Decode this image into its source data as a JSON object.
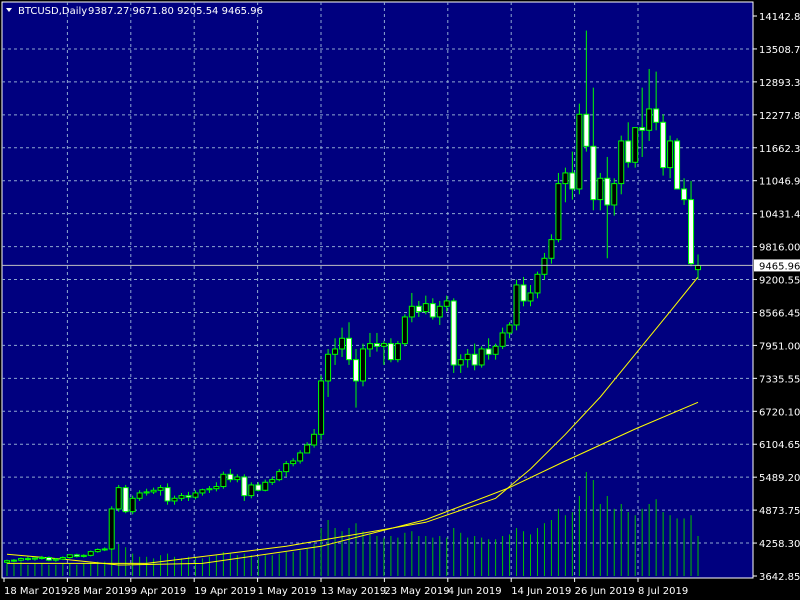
{
  "chart_data": {
    "type": "candlestick",
    "symbol_header": "BTCUSD,Daily",
    "ohlc_header": "9387.27 9671.80 9205.54 9465.96",
    "colors": {
      "background": "#000000",
      "plot_background": "#00007F",
      "grid": "#8FA8D0",
      "candle_stroke": "#00FF00",
      "bull_fill": "#000000",
      "bear_fill": "#FFFFFF",
      "volume": "#00C000",
      "ma": "#FFFF00",
      "text": "#FFFFFF",
      "current_line": "#C0C0C0"
    },
    "y_axis": {
      "range": [
        3642.85,
        14142.8
      ],
      "ticks": [
        "14142.80",
        "13508.70",
        "12893.35",
        "12277.80",
        "11662.35",
        "11046.90",
        "10431.45",
        "9816.00",
        "9200.55",
        "8566.45",
        "7951.00",
        "7335.55",
        "6720.10",
        "6104.65",
        "5489.20",
        "4873.75",
        "4258.30",
        "3642.85"
      ]
    },
    "current_price": "9465.96",
    "x_axis": {
      "labels": [
        "18 Mar 2019",
        "28 Mar 2019",
        "9 Apr 2019",
        "19 Apr 2019",
        "1 May 2019",
        "13 May 2019",
        "23 May 2019",
        "4 Jun 2019",
        "14 Jun 2019",
        "26 Jun 2019",
        "8 Jul 2019"
      ]
    },
    "candles": [
      [
        3900,
        3950,
        3880,
        3930
      ],
      [
        3930,
        3960,
        3900,
        3940
      ],
      [
        3940,
        3990,
        3920,
        3970
      ],
      [
        3970,
        4010,
        3930,
        3960
      ],
      [
        3960,
        3990,
        3930,
        3980
      ],
      [
        3980,
        4020,
        3950,
        3990
      ],
      [
        3990,
        4010,
        3920,
        3940
      ],
      [
        3940,
        3980,
        3910,
        3960
      ],
      [
        3960,
        4010,
        3940,
        3990
      ],
      [
        3990,
        4050,
        3970,
        4040
      ],
      [
        4040,
        4060,
        3990,
        4010
      ],
      [
        4010,
        4050,
        3990,
        4030
      ],
      [
        4030,
        4120,
        4010,
        4100
      ],
      [
        4100,
        4160,
        4080,
        4140
      ],
      [
        4140,
        4180,
        4110,
        4150
      ],
      [
        4150,
        4950,
        4130,
        4900
      ],
      [
        4900,
        5350,
        4850,
        5300
      ],
      [
        5300,
        5350,
        4820,
        4850
      ],
      [
        4850,
        5150,
        4800,
        5100
      ],
      [
        5100,
        5250,
        5050,
        5200
      ],
      [
        5200,
        5280,
        5150,
        5220
      ],
      [
        5220,
        5300,
        5180,
        5250
      ],
      [
        5250,
        5350,
        5150,
        5300
      ],
      [
        5300,
        5380,
        4980,
        5050
      ],
      [
        5050,
        5150,
        4980,
        5100
      ],
      [
        5100,
        5200,
        5050,
        5150
      ],
      [
        5150,
        5220,
        5050,
        5120
      ],
      [
        5120,
        5250,
        5080,
        5200
      ],
      [
        5200,
        5280,
        5150,
        5260
      ],
      [
        5260,
        5330,
        5200,
        5280
      ],
      [
        5280,
        5400,
        5230,
        5320
      ],
      [
        5320,
        5600,
        5280,
        5550
      ],
      [
        5550,
        5650,
        5400,
        5450
      ],
      [
        5450,
        5550,
        5400,
        5500
      ],
      [
        5500,
        5550,
        5050,
        5150
      ],
      [
        5150,
        5400,
        5100,
        5350
      ],
      [
        5350,
        5400,
        5230,
        5250
      ],
      [
        5250,
        5450,
        5230,
        5400
      ],
      [
        5400,
        5500,
        5350,
        5450
      ],
      [
        5450,
        5650,
        5420,
        5600
      ],
      [
        5600,
        5800,
        5500,
        5750
      ],
      [
        5750,
        5850,
        5700,
        5800
      ],
      [
        5800,
        6000,
        5750,
        5950
      ],
      [
        5950,
        6150,
        5950,
        6100
      ],
      [
        6100,
        6400,
        6050,
        6300
      ],
      [
        6300,
        7400,
        6200,
        7300
      ],
      [
        7300,
        7900,
        7000,
        7800
      ],
      [
        7800,
        8100,
        7600,
        7900
      ],
      [
        7900,
        8300,
        7750,
        8100
      ],
      [
        8100,
        8400,
        7600,
        7700
      ],
      [
        7700,
        7900,
        6800,
        7300
      ],
      [
        7300,
        8000,
        7200,
        7900
      ],
      [
        7900,
        8200,
        7750,
        8000
      ],
      [
        8000,
        8200,
        7850,
        7950
      ],
      [
        7950,
        8050,
        7600,
        8000
      ],
      [
        8000,
        8100,
        7650,
        7700
      ],
      [
        7700,
        8050,
        7650,
        8000
      ],
      [
        8000,
        8550,
        7950,
        8500
      ],
      [
        8500,
        8950,
        8400,
        8700
      ],
      [
        8700,
        8800,
        8500,
        8600
      ],
      [
        8600,
        8900,
        8550,
        8750
      ],
      [
        8750,
        8850,
        8450,
        8500
      ],
      [
        8500,
        8800,
        8350,
        8700
      ],
      [
        8700,
        8900,
        8600,
        8800
      ],
      [
        8800,
        8850,
        7450,
        7600
      ],
      [
        7600,
        7800,
        7450,
        7700
      ],
      [
        7700,
        7900,
        7550,
        7800
      ],
      [
        7800,
        8000,
        7500,
        7600
      ],
      [
        7600,
        7950,
        7550,
        7900
      ],
      [
        7900,
        8100,
        7700,
        7800
      ],
      [
        7800,
        8000,
        7700,
        7950
      ],
      [
        7950,
        8300,
        7900,
        8200
      ],
      [
        8200,
        8400,
        8100,
        8350
      ],
      [
        8350,
        9200,
        8250,
        9100
      ],
      [
        9100,
        9250,
        8700,
        8800
      ],
      [
        8800,
        9100,
        8700,
        8950
      ],
      [
        8950,
        9350,
        8850,
        9300
      ],
      [
        9300,
        9700,
        9200,
        9600
      ],
      [
        9600,
        10050,
        9500,
        9950
      ],
      [
        9950,
        11200,
        9900,
        11000
      ],
      [
        11000,
        11300,
        10650,
        11200
      ],
      [
        11200,
        11600,
        10700,
        10900
      ],
      [
        10900,
        12500,
        10800,
        12300
      ],
      [
        12300,
        13870,
        11600,
        11700
      ],
      [
        11700,
        12800,
        10500,
        10700
      ],
      [
        10700,
        11200,
        10500,
        11100
      ],
      [
        11100,
        11500,
        9600,
        10600
      ],
      [
        10600,
        11100,
        10400,
        11000
      ],
      [
        11000,
        11900,
        10800,
        11800
      ],
      [
        11800,
        12150,
        11300,
        11400
      ],
      [
        11400,
        12000,
        11300,
        12050
      ],
      [
        12050,
        12800,
        11500,
        12000
      ],
      [
        12000,
        13150,
        11800,
        12400
      ],
      [
        12400,
        13100,
        12000,
        12150
      ],
      [
        12150,
        12300,
        11150,
        11300
      ],
      [
        11300,
        11900,
        11100,
        11800
      ],
      [
        11800,
        11850,
        10900,
        10900
      ],
      [
        10900,
        11100,
        10600,
        10700
      ],
      [
        10700,
        11050,
        9450,
        9500
      ],
      [
        9387.27,
        9671.8,
        9205.54,
        9465.96
      ]
    ],
    "volumes": [
      0.08,
      0.08,
      0.09,
      0.07,
      0.08,
      0.08,
      0.07,
      0.07,
      0.08,
      0.08,
      0.07,
      0.08,
      0.09,
      0.09,
      0.09,
      0.18,
      0.2,
      0.18,
      0.14,
      0.12,
      0.12,
      0.11,
      0.13,
      0.14,
      0.12,
      0.11,
      0.12,
      0.12,
      0.11,
      0.12,
      0.13,
      0.15,
      0.14,
      0.13,
      0.14,
      0.13,
      0.12,
      0.13,
      0.13,
      0.14,
      0.15,
      0.15,
      0.16,
      0.17,
      0.2,
      0.3,
      0.35,
      0.3,
      0.28,
      0.3,
      0.33,
      0.28,
      0.26,
      0.25,
      0.24,
      0.25,
      0.24,
      0.27,
      0.28,
      0.25,
      0.25,
      0.24,
      0.25,
      0.24,
      0.3,
      0.27,
      0.24,
      0.25,
      0.24,
      0.23,
      0.23,
      0.25,
      0.26,
      0.3,
      0.28,
      0.26,
      0.3,
      0.33,
      0.35,
      0.42,
      0.38,
      0.4,
      0.5,
      0.65,
      0.6,
      0.45,
      0.5,
      0.42,
      0.45,
      0.4,
      0.38,
      0.42,
      0.45,
      0.48,
      0.4,
      0.38,
      0.36,
      0.36,
      0.38,
      0.25
    ],
    "ma_fast": [
      [
        0,
        3880
      ],
      [
        20,
        3880
      ],
      [
        40,
        4200
      ],
      [
        60,
        4650
      ],
      [
        70,
        5100
      ],
      [
        75,
        5650
      ],
      [
        80,
        6300
      ],
      [
        85,
        7000
      ],
      [
        90,
        7800
      ],
      [
        95,
        8600
      ],
      [
        99,
        9250
      ]
    ],
    "ma_slow": [
      [
        0,
        4050
      ],
      [
        8,
        3960
      ],
      [
        16,
        3850
      ],
      [
        28,
        3880
      ],
      [
        45,
        4200
      ],
      [
        60,
        4700
      ],
      [
        72,
        5300
      ],
      [
        80,
        5800
      ],
      [
        90,
        6400
      ],
      [
        99,
        6900
      ]
    ]
  }
}
